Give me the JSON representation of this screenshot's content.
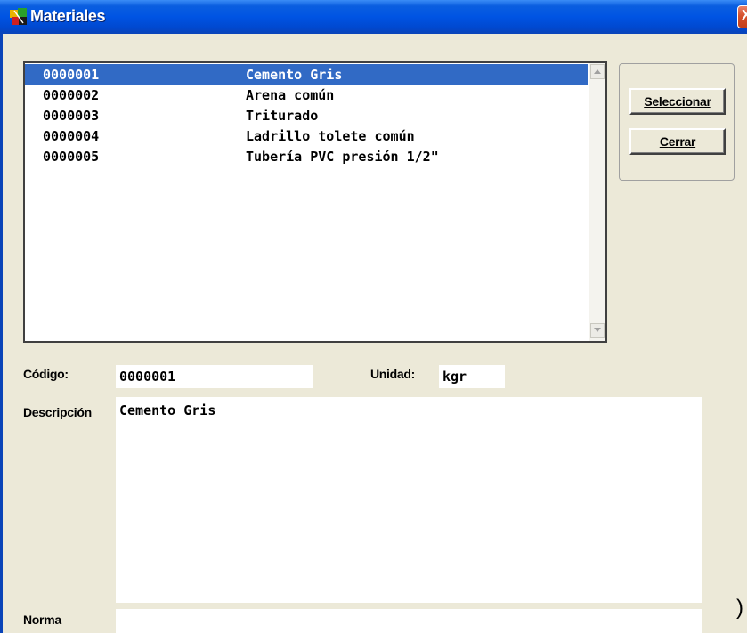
{
  "window": {
    "title": "Materiales",
    "close_glyph": "X"
  },
  "list": {
    "selected_index": 0,
    "items": [
      {
        "code": "0000001",
        "description": "Cemento Gris"
      },
      {
        "code": "0000002",
        "description": "Arena común"
      },
      {
        "code": "0000003",
        "description": "Triturado"
      },
      {
        "code": "0000004",
        "description": "Ladrillo tolete común"
      },
      {
        "code": "0000005",
        "description": "Tubería PVC presión 1/2\""
      }
    ]
  },
  "buttons": {
    "select_label": "Seleccionar",
    "close_label": "Cerrar"
  },
  "form": {
    "code_label": "Código:",
    "code_value": "0000001",
    "unit_label": "Unidad:",
    "unit_value": "kgr",
    "description_label": "Descripción",
    "description_value": "Cemento Gris",
    "norm_label": "Norma",
    "norm_value": ""
  },
  "stray_glyph": ")",
  "colors": {
    "titlebar": "#0054e3",
    "selection": "#316ac5",
    "window_bg": "#ece9d8"
  }
}
